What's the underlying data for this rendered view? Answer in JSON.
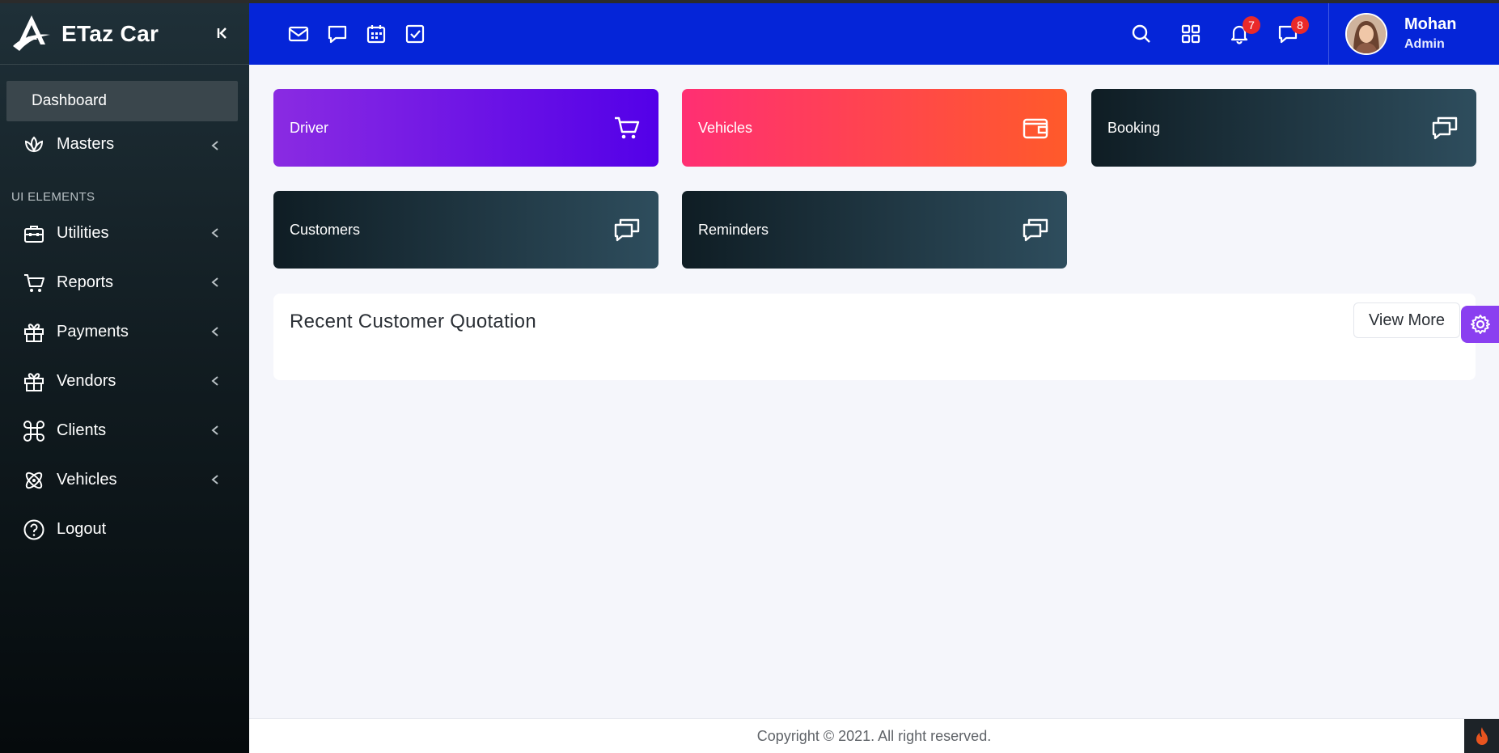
{
  "brand": {
    "name": "ETaz Car"
  },
  "sidebar": {
    "active": {
      "label": "Dashboard"
    },
    "masters": {
      "label": "Masters"
    },
    "section_title": "UI ELEMENTS",
    "items": [
      {
        "label": "Utilities",
        "icon": "briefcase-icon"
      },
      {
        "label": "Reports",
        "icon": "cart-icon"
      },
      {
        "label": "Payments",
        "icon": "gift-icon"
      },
      {
        "label": "Vendors",
        "icon": "gift-icon"
      },
      {
        "label": "Clients",
        "icon": "command-icon"
      },
      {
        "label": "Vehicles",
        "icon": "atom-icon"
      },
      {
        "label": "Logout",
        "icon": "help-circle-icon"
      }
    ]
  },
  "header": {
    "notifications_count": "7",
    "messages_count": "8",
    "user": {
      "name": "Mohan",
      "role": "Admin"
    }
  },
  "cards": [
    {
      "label": "Driver",
      "icon": "cart-icon"
    },
    {
      "label": "Vehicles",
      "icon": "wallet-icon"
    },
    {
      "label": "Booking",
      "icon": "chat-icon"
    },
    {
      "label": "Customers",
      "icon": "chat-icon"
    },
    {
      "label": "Reminders",
      "icon": "chat-icon"
    }
  ],
  "panel": {
    "title": "Recent Customer Quotation",
    "button": "View More"
  },
  "footer": {
    "text": "Copyright © 2021. All right reserved."
  },
  "colors": {
    "header": "#0525d8",
    "accent_purple": "#8a3ff0",
    "badge": "#ea2a2a"
  }
}
